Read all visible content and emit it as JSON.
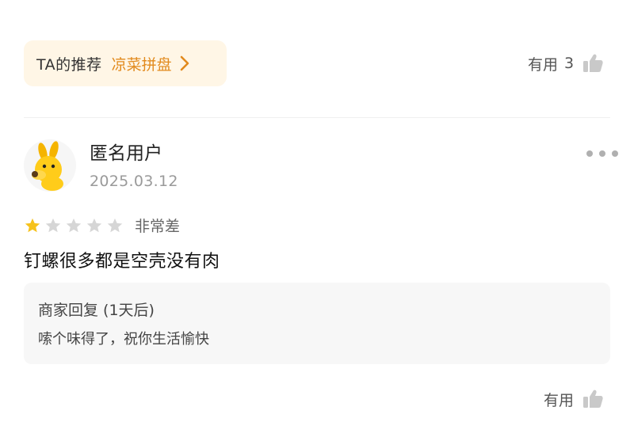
{
  "recommend": {
    "label": "TA的推荐",
    "dish": "凉菜拼盘"
  },
  "top_useful": {
    "label": "有用",
    "count": "3"
  },
  "review": {
    "username": "匿名用户",
    "date": "2025.03.12",
    "rating": 1,
    "rating_max": 5,
    "rating_text": "非常差",
    "text": "钉螺很多都是空壳没有肉",
    "merchant_reply": {
      "title": "商家回复 (1天后)",
      "body": "嗦个味得了，祝你生活愉快"
    },
    "useful_label": "有用"
  },
  "colors": {
    "accent": "#e28a1d",
    "star_active": "#f6c21c",
    "star_inactive": "#d6d6d6"
  },
  "icons": [
    "chevron-right-icon",
    "thumbs-up-icon",
    "more-dots-icon",
    "star-icon"
  ]
}
